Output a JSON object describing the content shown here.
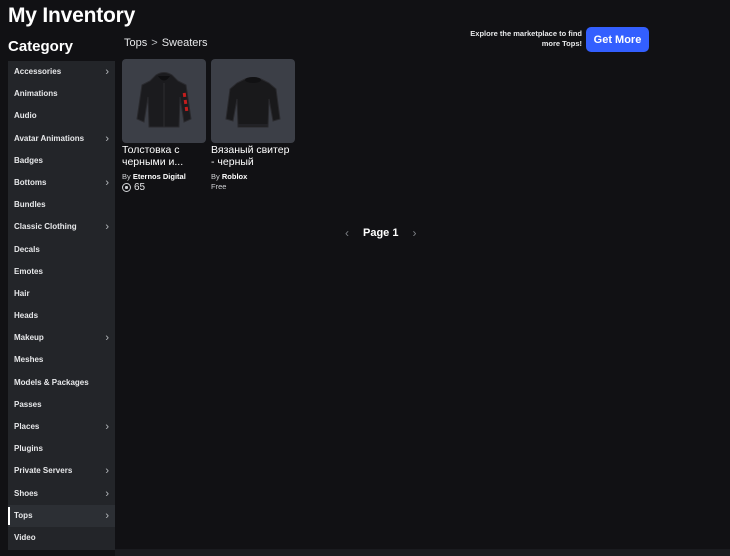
{
  "header": {
    "title": "My Inventory"
  },
  "sidebar": {
    "title": "Category",
    "items": [
      {
        "label": "Accessories",
        "has_submenu": true
      },
      {
        "label": "Animations",
        "has_submenu": false
      },
      {
        "label": "Audio",
        "has_submenu": false
      },
      {
        "label": "Avatar Animations",
        "has_submenu": true
      },
      {
        "label": "Badges",
        "has_submenu": false
      },
      {
        "label": "Bottoms",
        "has_submenu": true
      },
      {
        "label": "Bundles",
        "has_submenu": false
      },
      {
        "label": "Classic Clothing",
        "has_submenu": true
      },
      {
        "label": "Decals",
        "has_submenu": false
      },
      {
        "label": "Emotes",
        "has_submenu": false
      },
      {
        "label": "Hair",
        "has_submenu": false
      },
      {
        "label": "Heads",
        "has_submenu": false
      },
      {
        "label": "Makeup",
        "has_submenu": true
      },
      {
        "label": "Meshes",
        "has_submenu": false
      },
      {
        "label": "Models & Packages",
        "has_submenu": false
      },
      {
        "label": "Passes",
        "has_submenu": false
      },
      {
        "label": "Places",
        "has_submenu": true
      },
      {
        "label": "Plugins",
        "has_submenu": false
      },
      {
        "label": "Private Servers",
        "has_submenu": true
      },
      {
        "label": "Shoes",
        "has_submenu": true
      },
      {
        "label": "Tops",
        "has_submenu": true,
        "active": true
      },
      {
        "label": "Video",
        "has_submenu": false
      }
    ]
  },
  "breadcrumb": {
    "parent": "Tops",
    "separator": ">",
    "current": "Sweaters"
  },
  "promo": {
    "text": "Explore the marketplace to find more Tops!",
    "button_label": "Get More",
    "accent": "#335fff"
  },
  "items": [
    {
      "name": "Толстовка с черными и...",
      "by": "By",
      "creator": "Eternos Digital",
      "price": "65",
      "price_icon": "robux-icon",
      "color": "#1a1a1c",
      "accent": "#c21d1d"
    },
    {
      "name": "Вязаный свитер - черный",
      "by": "By",
      "creator": "Roblox",
      "price": "Free",
      "color": "#18191b"
    }
  ],
  "pagination": {
    "label": "Page 1",
    "prev_icon": "chevron-left-icon",
    "next_icon": "chevron-right-icon"
  },
  "colors": {
    "background": "#111114",
    "sidebar": "#232529",
    "thumb": "#3c3f47"
  }
}
